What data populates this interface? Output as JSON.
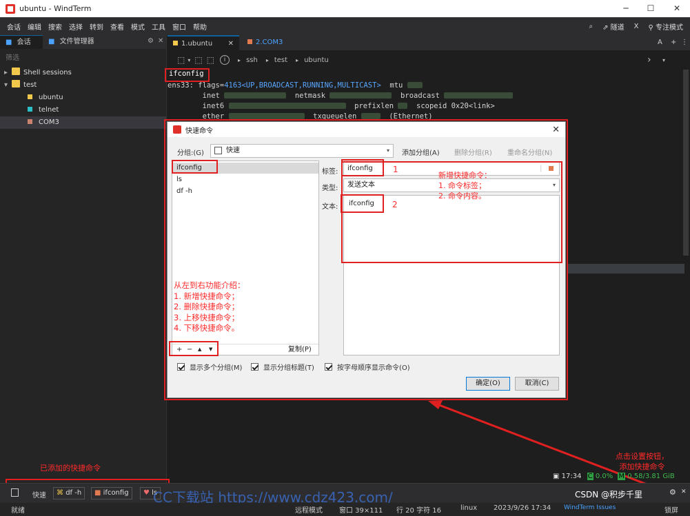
{
  "window": {
    "title": "ubuntu - WindTerm",
    "controls": {
      "minimize": "─",
      "maximize": "☐",
      "close": "✕"
    }
  },
  "menu": {
    "items": [
      "会话",
      "编辑",
      "搜索",
      "选择",
      "转到",
      "查看",
      "模式",
      "工具",
      "窗口",
      "帮助"
    ],
    "tunnel": "隧道",
    "focus_mode": "专注模式"
  },
  "sidebar": {
    "tabs": {
      "session": "会话",
      "file_manager": "文件管理器"
    },
    "filter_placeholder": "筛选",
    "tree": {
      "shell_sessions": "Shell sessions",
      "test": "test",
      "ubuntu": "ubuntu",
      "telnet": "telnet",
      "com3": "COM3"
    }
  },
  "terminal": {
    "tabs": {
      "tab1": "1.ubuntu",
      "tab2": "2.COM3"
    },
    "breadcrumb": {
      "ssh": "ssh",
      "test": "test",
      "ubuntu": "ubuntu"
    },
    "lines": {
      "cmd": "ifconfig",
      "l1a": "ens33: flags=",
      "l1b": "4163<UP,BROADCAST,RUNNING,MULTICAST>",
      "l1c": "  mtu ",
      "l2a": "        inet ",
      "l2b": "  netmask ",
      "l2c": "  broadcast ",
      "l3a": "        inet6 ",
      "l3b": "  prefixlen ",
      "l3c": "  scopeid 0x20<link>",
      "l4a": "        ether ",
      "l4b": "  txqueuelen ",
      "l4c": "  (Ethernet)"
    }
  },
  "dialog": {
    "title": "快速命令",
    "group_label": "分组:(G)",
    "group_value": "快速",
    "add_group": "添加分组(A)",
    "delete_group": "删除分组(R)",
    "rename_group": "重命名分组(N)",
    "commands": [
      "ifconfig",
      "ls",
      "df -h"
    ],
    "tag_label": "标签:",
    "tag_value": "ifconfig",
    "type_label": "类型:",
    "type_value": "发送文本",
    "text_label": "文本:",
    "text_value": "ifconfig",
    "copy_button": "复制(P)",
    "list_buttons": {
      "add": "+",
      "remove": "−",
      "up": "▲",
      "down": "▼"
    },
    "checkboxes": {
      "show_groups": "显示多个分组(M)",
      "show_titles": "显示分组标题(T)",
      "sort_alpha": "按字母顺序显示命令(O)"
    },
    "ok": "确定(O)",
    "cancel": "取消(C)"
  },
  "annotations": {
    "one": "1",
    "two": "2",
    "new_cmd": "新增快捷命令：\n1. 命令标签；\n2. 命令内容。",
    "functions": "从左到右功能介绍：\n1. 新增快捷命令；\n2. 删除快捷命令；\n3. 上移快捷命令；\n4. 下移快捷命令。",
    "added": "已添加的快捷命令",
    "click_settings": "点击设置按钮，\n添加快捷命令"
  },
  "bottom": {
    "label": "快速",
    "cmds": [
      {
        "icon": "⌘",
        "text": "df -h"
      },
      {
        "icon": "■",
        "text": "ifconfig"
      },
      {
        "icon": "♥",
        "text": "ls"
      }
    ],
    "time": "17:34",
    "cpu": "0.0%",
    "mem": "0.58/3.81 GiB",
    "watermark": "CC下载站 https://www.cdz423.com/",
    "csdn": "CSDN @积步千里"
  },
  "status": {
    "ready": "就绪",
    "mode": "远程模式",
    "window": "窗口 39×111",
    "cursor": "行 20 字符 16",
    "os": "linux",
    "datetime": "2023/9/26 17:34",
    "issues": "WindTerm Issues",
    "lock": "锁屏"
  },
  "colors": {
    "accent": "#0e639c",
    "annotation": "#e02020",
    "yellow": "#f2c94c",
    "cyan": "#2bc0c8",
    "salmon": "#c9826b"
  }
}
